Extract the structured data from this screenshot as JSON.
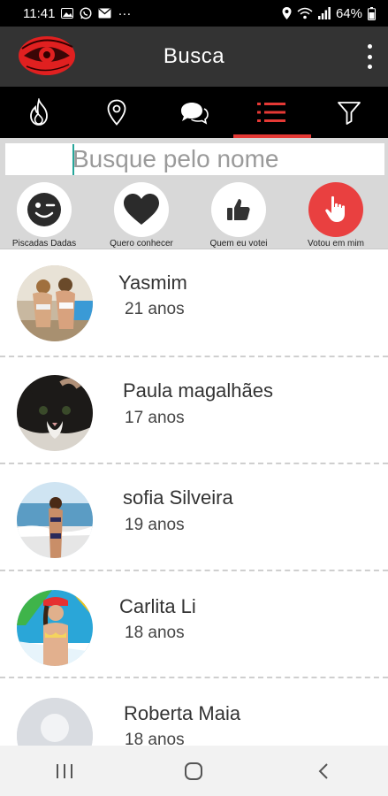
{
  "status_bar": {
    "time": "11:41",
    "more": "···",
    "battery": "64%"
  },
  "app_bar": {
    "title": "Busca"
  },
  "tabs": [
    {
      "icon": "flame-icon"
    },
    {
      "icon": "location-pin-icon"
    },
    {
      "icon": "chat-bubbles-icon"
    },
    {
      "icon": "list-icon",
      "active": true
    },
    {
      "icon": "filter-icon"
    }
  ],
  "search": {
    "placeholder": "Busque pelo nome",
    "value": ""
  },
  "filters": [
    {
      "label": "Piscadas Dadas",
      "icon": "wink-face-icon"
    },
    {
      "label": "Quero conhecer",
      "icon": "heart-icon"
    },
    {
      "label": "Quem eu votei",
      "icon": "thumbs-up-icon"
    },
    {
      "label": "Votou em mim",
      "icon": "pointing-hand-icon"
    }
  ],
  "users": [
    {
      "name": "Yasmim",
      "age": "21 anos"
    },
    {
      "name": "Paula magalhães",
      "age": "17 anos"
    },
    {
      "name": "sofia Silveira",
      "age": "19 anos"
    },
    {
      "name": "Carlita Li",
      "age": "18 anos"
    },
    {
      "name": "Roberta Maia",
      "age": "18 anos"
    }
  ],
  "colors": {
    "accent": "#e53935",
    "app_bar": "#333333",
    "tab_bar": "#000000",
    "filter_bg": "#d8d8d8"
  }
}
